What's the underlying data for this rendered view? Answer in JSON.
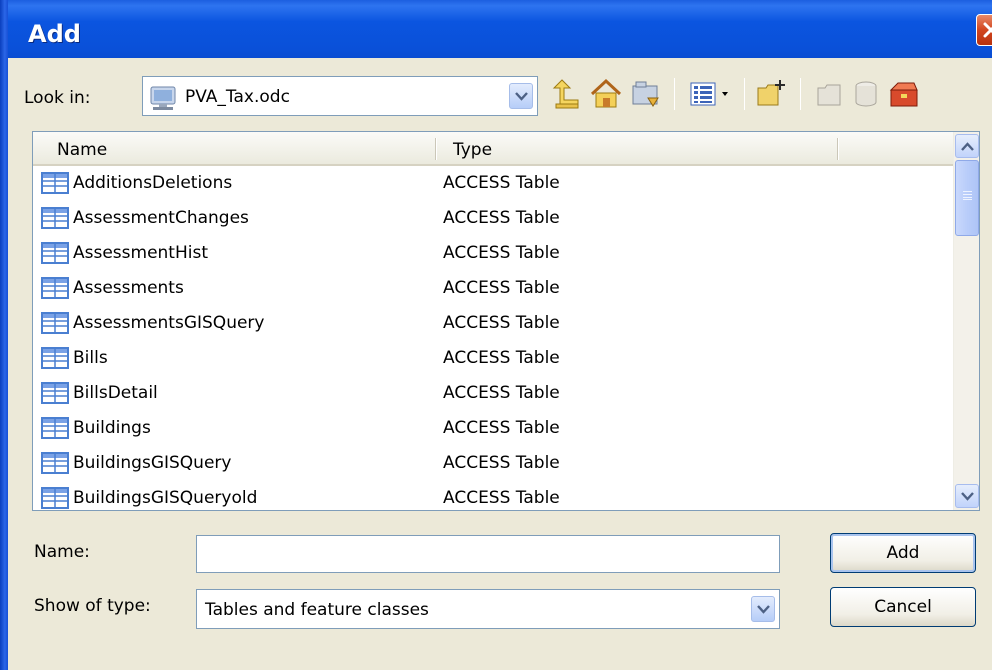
{
  "window": {
    "title": "Add"
  },
  "lookin": {
    "label": "Look in:",
    "value": "PVA_Tax.odc"
  },
  "toolbar": {
    "icons": [
      "up-one-level-icon",
      "home-icon",
      "connect-folder-icon",
      "view-menu-icon",
      "new-folder-icon",
      "new-item-icon",
      "new-table-icon",
      "toolbox-icon"
    ]
  },
  "list": {
    "columns": {
      "name": "Name",
      "type": "Type"
    },
    "rows": [
      {
        "name": "AdditionsDeletions",
        "type": "ACCESS Table"
      },
      {
        "name": "AssessmentChanges",
        "type": "ACCESS Table"
      },
      {
        "name": "AssessmentHist",
        "type": "ACCESS Table"
      },
      {
        "name": "Assessments",
        "type": "ACCESS Table"
      },
      {
        "name": "AssessmentsGISQuery",
        "type": "ACCESS Table"
      },
      {
        "name": "Bills",
        "type": "ACCESS Table"
      },
      {
        "name": "BillsDetail",
        "type": "ACCESS Table"
      },
      {
        "name": "Buildings",
        "type": "ACCESS Table"
      },
      {
        "name": "BuildingsGISQuery",
        "type": "ACCESS Table"
      },
      {
        "name": "BuildingsGISQueryold",
        "type": "ACCESS Table"
      }
    ]
  },
  "form": {
    "name_label": "Name:",
    "name_value": "",
    "type_label": "Show of type:",
    "type_value": "Tables and feature classes"
  },
  "buttons": {
    "add": "Add",
    "cancel": "Cancel"
  },
  "colors": {
    "titlebar": "#0a50d8",
    "dialog_bg": "#ece9d8",
    "field_border": "#7f9db9",
    "icon_blue": "#4a7fd1"
  }
}
